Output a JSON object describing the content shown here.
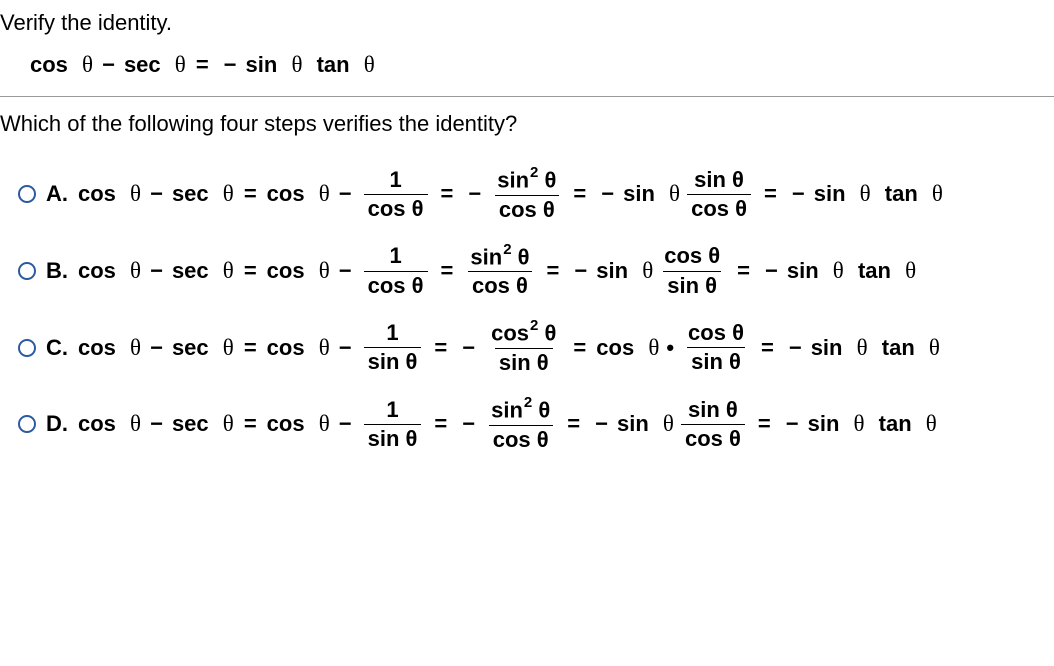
{
  "instruction": "Verify the identity.",
  "identity": {
    "lhs_a": "cos",
    "lhs_b": "sec",
    "rhs_trig1": "sin",
    "rhs_trig2": "tan"
  },
  "question": "Which of the following four steps verifies the identity?",
  "theta": "θ",
  "ops": {
    "eq": "=",
    "minus": "−",
    "dot": "•"
  },
  "options": [
    {
      "label": "A.",
      "step1_num": "1",
      "step1_den": "cos",
      "step2_sign": "−",
      "step2_num_fn": "sin",
      "step2_pow": "2",
      "step2_den": "cos",
      "step3_sign": "−",
      "step3_lead": "sin",
      "step3_num": "sin",
      "step3_den": "cos",
      "final_sign": "−",
      "final_a": "sin",
      "final_b": "tan"
    },
    {
      "label": "B.",
      "step1_num": "1",
      "step1_den": "cos",
      "step2_sign": "",
      "step2_num_fn": "sin",
      "step2_pow": "2",
      "step2_den": "cos",
      "step3_sign": "−",
      "step3_lead": "sin",
      "step3_num": "cos",
      "step3_den": "sin",
      "final_sign": "−",
      "final_a": "sin",
      "final_b": "tan"
    },
    {
      "label": "C.",
      "step1_num": "1",
      "step1_den": "sin",
      "step2_sign": "−",
      "step2_num_fn": "cos",
      "step2_pow": "2",
      "step2_den": "sin",
      "step3_sign": "",
      "step3_lead": "cos",
      "step3_num": "cos",
      "step3_den": "sin",
      "step3_dot": true,
      "final_sign": "−",
      "final_a": "sin",
      "final_b": "tan"
    },
    {
      "label": "D.",
      "step1_num": "1",
      "step1_den": "sin",
      "step2_sign": "−",
      "step2_num_fn": "sin",
      "step2_pow": "2",
      "step2_den": "cos",
      "step3_sign": "−",
      "step3_lead": "sin",
      "step3_num": "sin",
      "step3_den": "cos",
      "final_sign": "−",
      "final_a": "sin",
      "final_b": "tan"
    }
  ]
}
